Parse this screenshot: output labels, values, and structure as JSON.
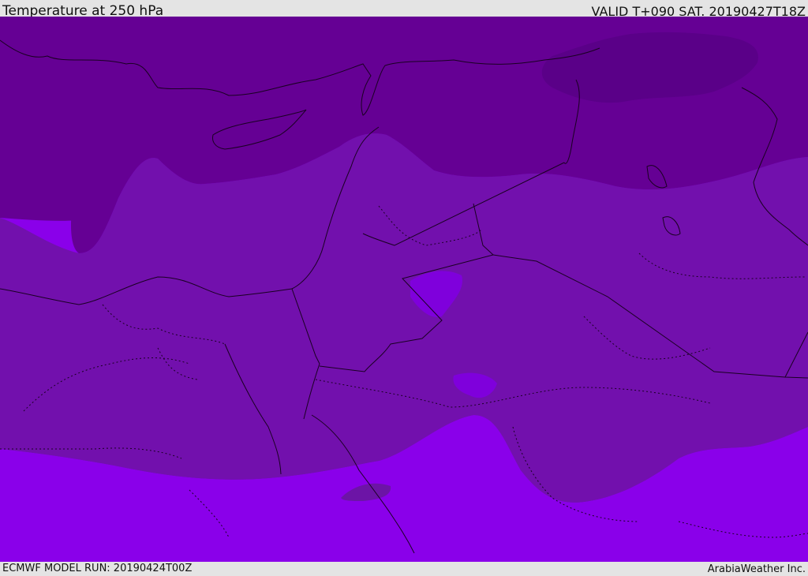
{
  "header": {
    "title": "Temperature at 250 hPa",
    "valid_time": "VALID T+090 SAT. 20190427T18Z"
  },
  "footer": {
    "model_run": "ECMWF MODEL RUN: 20190424T00Z",
    "credit": "ArabiaWeather Inc."
  },
  "map": {
    "variable": "temperature",
    "pressure_level_hpa": 250,
    "colors": {
      "coldest": "#5a0088",
      "cold": "#650094",
      "mid": "#7210ad",
      "mild": "#6c14a6",
      "warm": "#7f00dc",
      "warmest": "#8a00ea"
    }
  }
}
